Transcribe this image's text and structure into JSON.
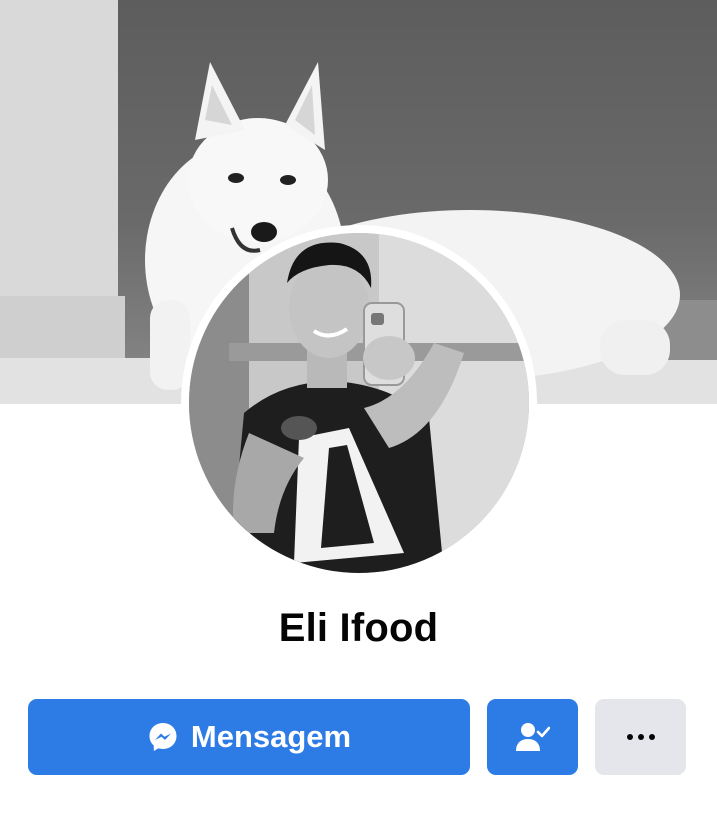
{
  "profile": {
    "name": "Eli Ifood",
    "cover_photo": "white-dog-cover-photo",
    "avatar_photo": "selfie-profile-photo"
  },
  "actions": {
    "message_label": "Mensagem",
    "message_icon": "messenger-icon",
    "friend_icon": "user-check-icon",
    "more_icon": "more-dots-icon"
  },
  "colors": {
    "primary": "#2d7be5",
    "secondary_button": "#e4e6eb",
    "text": "#050505",
    "background": "#ffffff"
  }
}
